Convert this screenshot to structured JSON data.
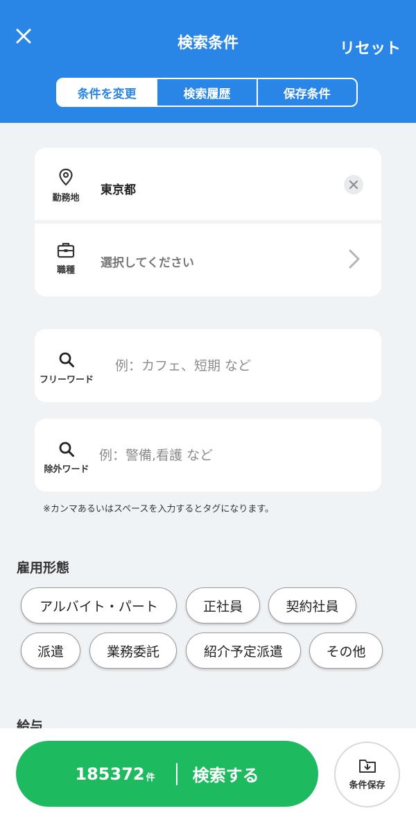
{
  "header": {
    "title": "検索条件",
    "reset_label": "リセット",
    "tabs": [
      {
        "label": "条件を変更",
        "active": true
      },
      {
        "label": "検索履歴",
        "active": false
      },
      {
        "label": "保存条件",
        "active": false
      }
    ]
  },
  "location_card": {
    "workplace": {
      "icon": "location-pin-icon",
      "label": "勤務地",
      "value": "東京都"
    },
    "job_type": {
      "icon": "briefcase-icon",
      "label": "職種",
      "placeholder": "選択してください"
    }
  },
  "free_word": {
    "icon": "search-icon",
    "label": "フリーワード",
    "placeholder": "例：カフェ、短期 など",
    "value": ""
  },
  "exclude_word": {
    "icon": "search-icon",
    "label": "除外ワード",
    "placeholder": "例：警備,看護 など",
    "value": ""
  },
  "note": "※カンマあるいはスペースを入力するとタグになります。",
  "employment": {
    "title": "雇用形態",
    "chips": [
      "アルバイト・パート",
      "正社員",
      "契約社員",
      "派遣",
      "業務委託",
      "紹介予定派遣",
      "その他"
    ]
  },
  "salary": {
    "title": "給与"
  },
  "footer": {
    "count": "185372",
    "count_unit": "件",
    "search_label": "検索する",
    "save_label": "条件保存"
  },
  "colors": {
    "header_blue": "#2a86e6",
    "search_green": "#1dba5f",
    "background": "#f0f3f6"
  }
}
